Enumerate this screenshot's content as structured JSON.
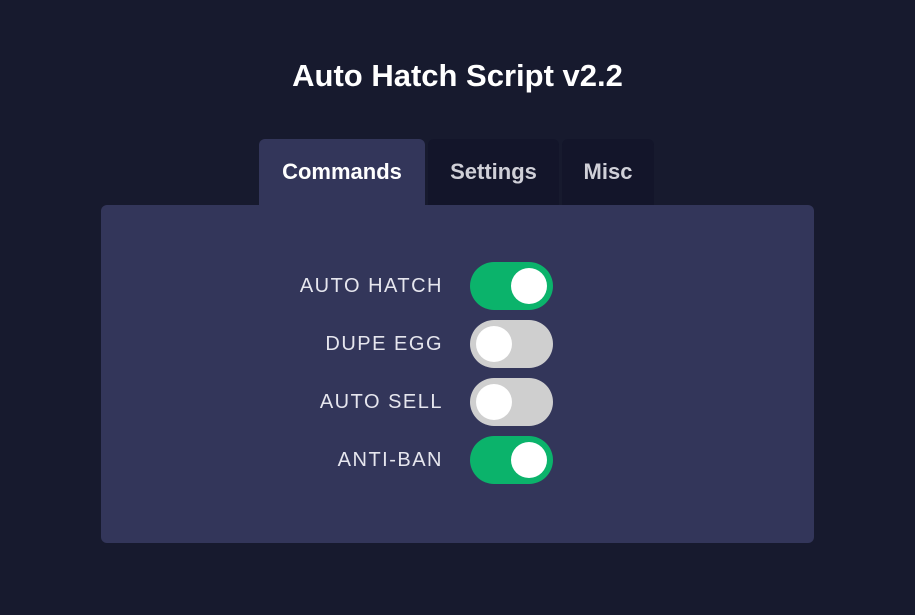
{
  "title": "Auto Hatch Script v2.2",
  "tabs": [
    {
      "label": "Commands",
      "active": true
    },
    {
      "label": "Settings",
      "active": false
    },
    {
      "label": "Misc",
      "active": false
    }
  ],
  "commands": [
    {
      "label": "AUTO HATCH",
      "enabled": true
    },
    {
      "label": "DUPE EGG",
      "enabled": false
    },
    {
      "label": "AUTO SELL",
      "enabled": false
    },
    {
      "label": "ANTI-BAN",
      "enabled": true
    }
  ],
  "colors": {
    "background": "#171a2e",
    "panel": "#33365a",
    "toggle_on": "#0bb36b",
    "toggle_off": "#cfcfcf"
  }
}
